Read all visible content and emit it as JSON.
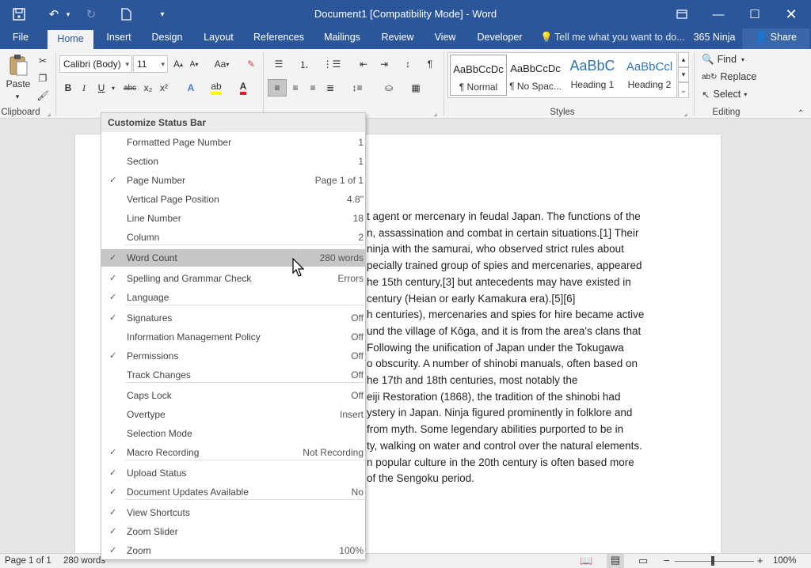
{
  "window": {
    "title": "Document1 [Compatibility Mode] - Word"
  },
  "ribbon_tabs": [
    "File",
    "Home",
    "Insert",
    "Design",
    "Layout",
    "References",
    "Mailings",
    "Review",
    "View",
    "Developer"
  ],
  "tell_me": "Tell me what you want to do...",
  "account": "365 Ninja",
  "share": "Share",
  "clipboard": {
    "paste": "Paste",
    "group": "Clipboard"
  },
  "font": {
    "name": "Calibri (Body)",
    "size": "11",
    "aa": "Aa",
    "bold": "B",
    "italic": "I",
    "underline": "U",
    "strike": "abc",
    "sub": "x₂",
    "sup": "x²"
  },
  "styles": {
    "group": "Styles",
    "items": [
      {
        "preview": "AaBbCcDc",
        "name": "¶ Normal"
      },
      {
        "preview": "AaBbCcDc",
        "name": "¶ No Spac..."
      },
      {
        "preview": "AaBbC",
        "name": "Heading 1"
      },
      {
        "preview": "AaBbCcl",
        "name": "Heading 2"
      }
    ]
  },
  "editing": {
    "find": "Find",
    "replace": "Replace",
    "select": "Select",
    "group": "Editing"
  },
  "menu": {
    "title": "Customize Status Bar",
    "items": [
      {
        "label": "Formatted Page Number",
        "value": "1",
        "checked": false
      },
      {
        "label": "Section",
        "value": "1",
        "checked": false
      },
      {
        "label": "Page Number",
        "value": "Page 1 of 1",
        "checked": true
      },
      {
        "label": "Vertical Page Position",
        "value": "4.8\"",
        "checked": false
      },
      {
        "label": "Line Number",
        "value": "18",
        "checked": false
      },
      {
        "label": "Column",
        "value": "2",
        "checked": false
      },
      {
        "label": "Word Count",
        "value": "280 words",
        "checked": true
      },
      {
        "label": "Spelling and Grammar Check",
        "value": "Errors",
        "checked": true
      },
      {
        "label": "Language",
        "value": "",
        "checked": true
      },
      {
        "label": "Signatures",
        "value": "Off",
        "checked": true
      },
      {
        "label": "Information Management Policy",
        "value": "Off",
        "checked": false
      },
      {
        "label": "Permissions",
        "value": "Off",
        "checked": true
      },
      {
        "label": "Track Changes",
        "value": "Off",
        "checked": false
      },
      {
        "label": "Caps Lock",
        "value": "Off",
        "checked": false
      },
      {
        "label": "Overtype",
        "value": "Insert",
        "checked": false
      },
      {
        "label": "Selection Mode",
        "value": "",
        "checked": false
      },
      {
        "label": "Macro Recording",
        "value": "Not Recording",
        "checked": true
      },
      {
        "label": "Upload Status",
        "value": "",
        "checked": true
      },
      {
        "label": "Document Updates Available",
        "value": "No",
        "checked": true
      },
      {
        "label": "View Shortcuts",
        "value": "",
        "checked": true
      },
      {
        "label": "Zoom Slider",
        "value": "",
        "checked": true
      },
      {
        "label": "Zoom",
        "value": "100%",
        "checked": true
      }
    ]
  },
  "document_lines": [
    "t agent or mercenary in feudal Japan. The functions of the",
    "n, assassination and combat in certain situations.[1] Their",
    "ninja with the samurai, who observed strict rules about",
    "pecially trained group of spies and mercenaries, appeared",
    "he 15th century,[3] but antecedents may have existed in",
    "century (Heian or early Kamakura era).[5][6]",
    "h centuries), mercenaries and spies for hire became active",
    "und the village of Kōga, and it is from the area's clans that",
    "Following the unification of Japan under the Tokugawa",
    "o obscurity. A number of shinobi manuals, often based on",
    "he 17th and 18th centuries, most notably the",
    "eiji Restoration (1868), the tradition of the shinobi had",
    "ystery in Japan. Ninja figured prominently in folklore and",
    "from myth. Some legendary abilities purported to be in",
    "ty, walking on water and control over the natural elements.",
    "n popular culture in the 20th century is often based more",
    "of the Sengoku period."
  ],
  "status": {
    "page": "Page 1 of 1",
    "words": "280 words",
    "zoom": "100%"
  }
}
